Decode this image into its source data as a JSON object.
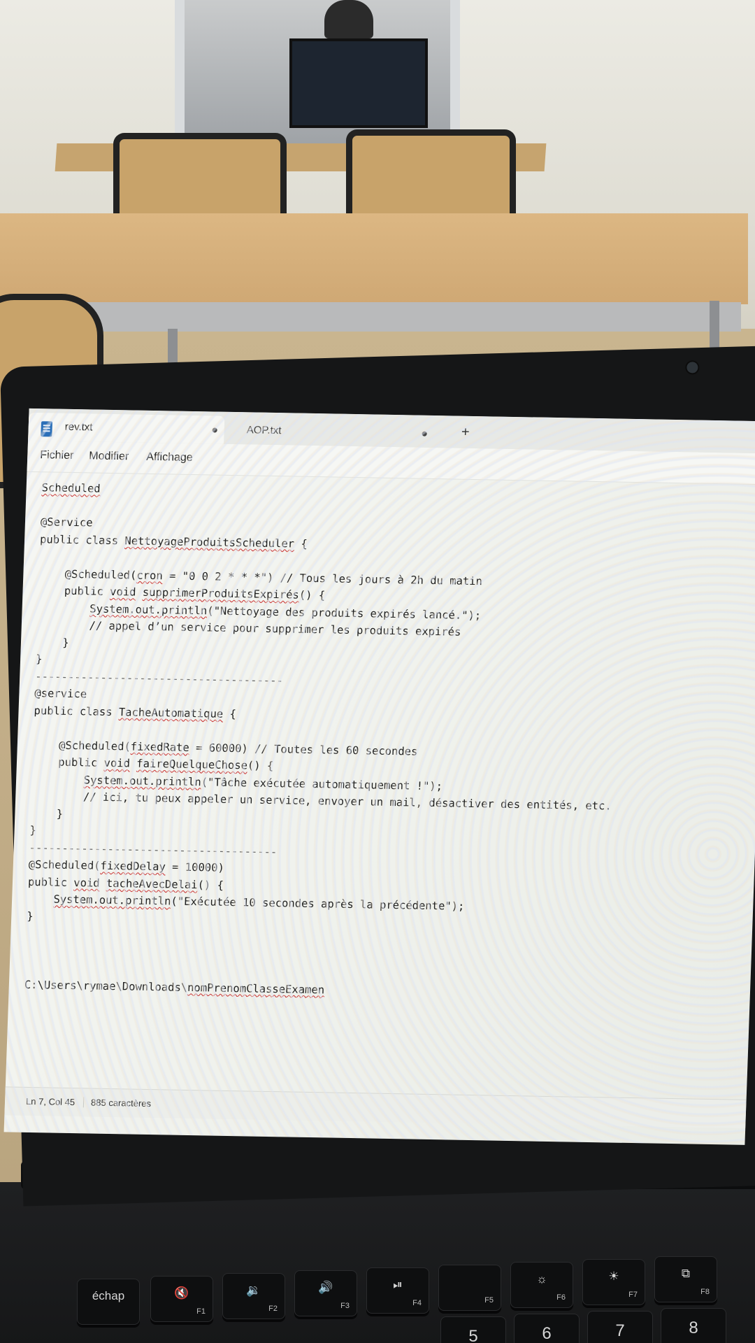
{
  "notepad": {
    "tabs": [
      {
        "title": "rev.txt",
        "active": true
      },
      {
        "title": "AOP.txt",
        "active": false
      }
    ],
    "new_tab_symbol": "+",
    "menu": [
      "Fichier",
      "Modifier",
      "Affichage"
    ],
    "lines": [
      "Scheduled",
      "",
      "@Service",
      "public class NettoyageProduitsScheduler {",
      "",
      "    @Scheduled(cron = \"0 0 2 * * *\") // Tous les jours à 2h du matin",
      "    public void supprimerProduitsExpirés() {",
      "        System.out.println(\"Nettoyage des produits expirés lancé.\");",
      "        // appel d’un service pour supprimer les produits expirés",
      "    }",
      "}",
      "--------------------------------------",
      "@service",
      "public class TacheAutomatique {",
      "",
      "    @Scheduled(fixedRate = 60000) // Toutes les 60 secondes",
      "    public void faireQuelqueChose() {",
      "        System.out.println(\"Tâche exécutée automatiquement !\");",
      "        // ici, tu peux appeler un service, envoyer un mail, désactiver des entités, etc.",
      "    }",
      "}",
      "--------------------------------------",
      "@Scheduled(fixedDelay = 10000)",
      "public void tacheAvecDelai() {",
      "    System.out.println(\"Exécutée 10 secondes après la précédente\");",
      "}",
      "",
      "",
      "",
      "C:\\Users\\rymae\\Downloads\\nomPrenomClasseExamen"
    ],
    "status": {
      "position": "Ln 7, Col 45",
      "characters": "885 caractères"
    }
  },
  "keyboard": {
    "fn_keys": [
      {
        "label": "échap",
        "fn": ""
      },
      {
        "label": "🔇",
        "fn": "F1"
      },
      {
        "label": "🔉",
        "fn": "F2"
      },
      {
        "label": "🔊",
        "fn": "F3"
      },
      {
        "label": "⏯",
        "fn": "F4"
      },
      {
        "label": "",
        "fn": "F5"
      },
      {
        "label": "☼",
        "fn": "F6"
      },
      {
        "label": "☀",
        "fn": "F7"
      },
      {
        "label": "⧉",
        "fn": "F8"
      }
    ],
    "number_keys": [
      "5",
      "6",
      "7",
      "8"
    ]
  }
}
